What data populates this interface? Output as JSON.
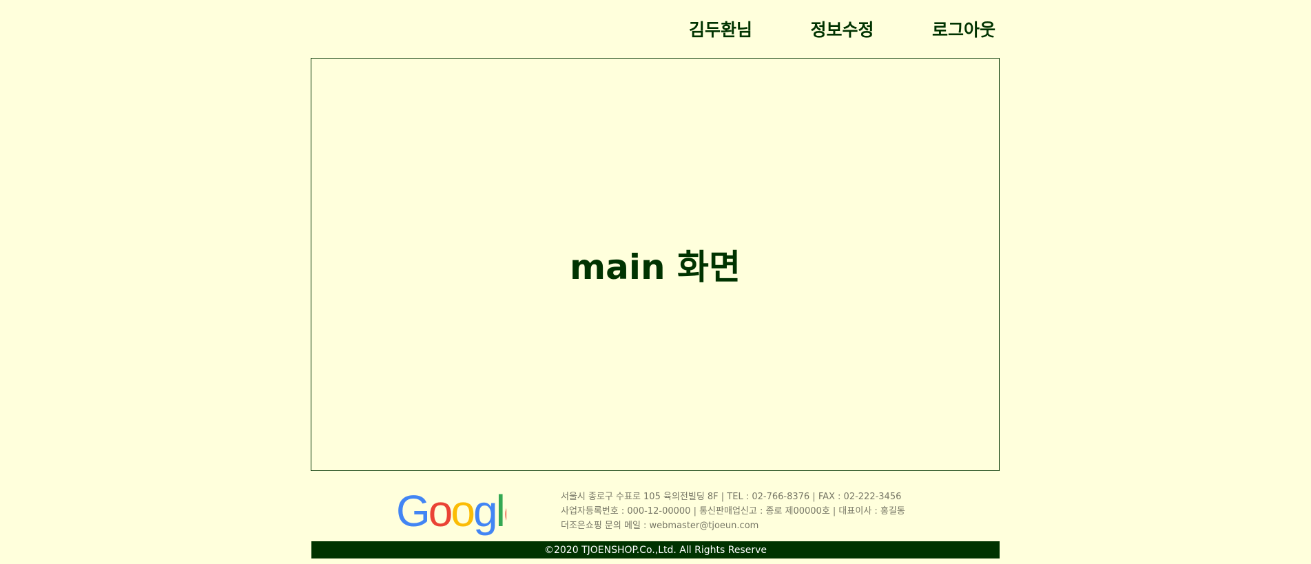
{
  "nav": {
    "user": "김두환님",
    "edit_info": "정보수정",
    "logout": "로그아웃"
  },
  "main": {
    "title": "main 화면"
  },
  "footer": {
    "logo_text": "Google",
    "info_lines": [
      "서울시 종로구 수표로 105 육의전빌딩 8F | TEL : 02-766-8376 | FAX : 02-222-3456",
      "사업자등록번호 : 000-12-00000 | 통신판매업신고 : 종로 제00000호 | 대표이사 : 홍길동",
      "더조은쇼핑 문의 메일 : webmaster@tjoeun.com"
    ],
    "copyright": "©2020 TJOENSHOP.Co.,Ltd. All Rights Reserve"
  },
  "colors": {
    "background": "#ffffdc",
    "accent": "#003300",
    "google_blue": "#4285F4",
    "google_red": "#EA4335",
    "google_yellow": "#FBBC05",
    "google_green": "#34A853"
  }
}
